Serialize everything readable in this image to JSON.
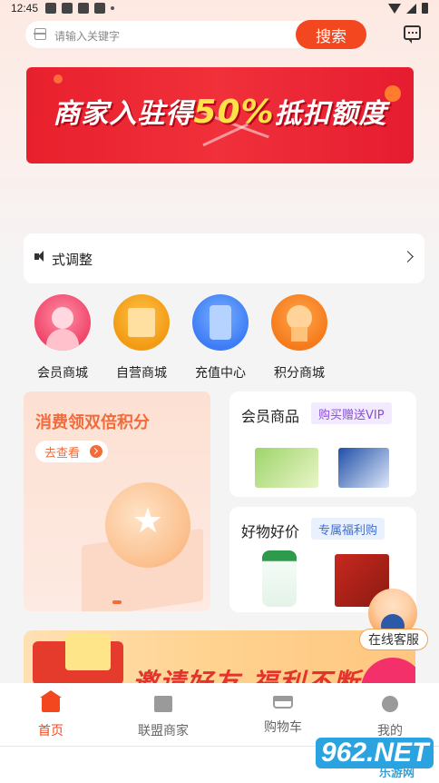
{
  "status_bar": {
    "time": "12:45"
  },
  "search": {
    "placeholder": "请输入关键字",
    "button_label": "搜索"
  },
  "banner": {
    "text_before": "商家入驻得",
    "highlight": "50%",
    "text_after": "抵扣额度"
  },
  "notice": {
    "text": "式调整"
  },
  "quick_menu": [
    {
      "label": "会员商城",
      "icon": "member-icon"
    },
    {
      "label": "自营商城",
      "icon": "self-store-icon"
    },
    {
      "label": "充值中心",
      "icon": "phone-recharge-icon"
    },
    {
      "label": "积分商城",
      "icon": "points-badge-icon"
    }
  ],
  "promo": {
    "title": "消费领双倍积分",
    "button_label": "去查看"
  },
  "side_cards": [
    {
      "title": "会员商品",
      "tag": "购买赠送VIP"
    },
    {
      "title": "好物好价",
      "tag": "专属福利购"
    }
  ],
  "customer_service": {
    "label": "在线客服"
  },
  "invite_banner": {
    "text": "邀请好友 福利不断"
  },
  "tab_bar": [
    {
      "label": "首页",
      "active": true
    },
    {
      "label": "联盟商家",
      "active": false
    },
    {
      "label": "购物车",
      "active": false
    },
    {
      "label": "我的",
      "active": false
    }
  ],
  "watermark": {
    "logo": "962.NET",
    "sub": "乐游网"
  },
  "colors": {
    "accent": "#f2471f",
    "promo_text": "#f26b3a",
    "purple_tag": "#8a4cd8",
    "blue_tag": "#3c6fd6"
  }
}
